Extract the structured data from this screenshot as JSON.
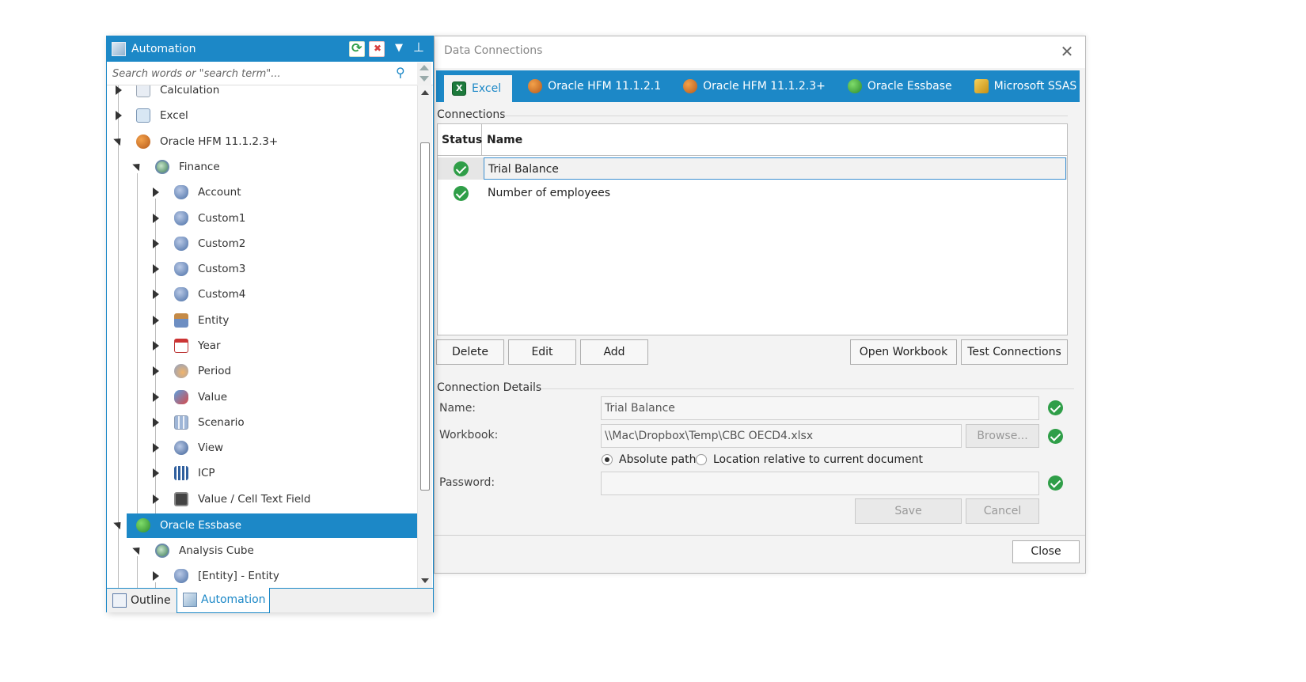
{
  "dialog": {
    "title": "Data Connections",
    "tabs": [
      {
        "label": "Excel",
        "icon": "excel-icon",
        "active": true
      },
      {
        "label": "Oracle HFM 11.1.2.1",
        "icon": "oracle-hfm-icon"
      },
      {
        "label": "Oracle HFM 11.1.2.3+",
        "icon": "oracle-hfm-icon"
      },
      {
        "label": "Oracle Essbase",
        "icon": "oracle-essbase-icon"
      },
      {
        "label": "Microsoft SSAS",
        "icon": "microsoft-ssas-icon"
      }
    ],
    "connections_label": "Connections",
    "grid_headers": {
      "status": "Status",
      "name": "Name"
    },
    "connections": [
      {
        "name": "Trial Balance",
        "status": "ok",
        "selected": true
      },
      {
        "name": "Number of employees",
        "status": "ok",
        "selected": false
      }
    ],
    "buttons": {
      "delete": "Delete",
      "edit": "Edit",
      "add": "Add",
      "open_workbook": "Open Workbook",
      "test_connections": "Test Connections"
    },
    "details": {
      "label": "Connection Details",
      "name_label": "Name:",
      "name_value": "Trial Balance",
      "workbook_label": "Workbook:",
      "workbook_value": "\\\\Mac\\Dropbox\\Temp\\CBC OECD4.xlsx",
      "browse": "Browse...",
      "absolute_path": "Absolute path",
      "relative_path": "Location relative to current document",
      "path_mode": "absolute",
      "password_label": "Password:",
      "password_value": "",
      "save": "Save",
      "cancel": "Cancel"
    },
    "close": "Close"
  },
  "panel": {
    "title": "Automation",
    "search_placeholder": "Search words or \"search term\"...",
    "tree": [
      {
        "label": "Calculation",
        "icon": "calculation-icon",
        "depth": 0,
        "expander": "collapsed"
      },
      {
        "label": "Excel",
        "icon": "excel-icon",
        "depth": 0,
        "expander": "collapsed"
      },
      {
        "label": "Oracle HFM 11.1.2.3+",
        "icon": "oracle-hfm-icon",
        "depth": 0,
        "expander": "expanded"
      },
      {
        "label": "Finance",
        "icon": "cube-icon",
        "depth": 1,
        "expander": "expanded"
      },
      {
        "label": "Account",
        "icon": "account-dimension-icon",
        "depth": 2,
        "expander": "collapsed"
      },
      {
        "label": "Custom1",
        "icon": "custom-dimension-icon",
        "depth": 2,
        "expander": "collapsed"
      },
      {
        "label": "Custom2",
        "icon": "custom-dimension-icon",
        "depth": 2,
        "expander": "collapsed"
      },
      {
        "label": "Custom3",
        "icon": "custom-dimension-icon",
        "depth": 2,
        "expander": "collapsed"
      },
      {
        "label": "Custom4",
        "icon": "custom-dimension-icon",
        "depth": 2,
        "expander": "collapsed"
      },
      {
        "label": "Entity",
        "icon": "entity-dimension-icon",
        "depth": 2,
        "expander": "collapsed"
      },
      {
        "label": "Year",
        "icon": "calendar-icon",
        "depth": 2,
        "expander": "collapsed"
      },
      {
        "label": "Period",
        "icon": "period-dimension-icon",
        "depth": 2,
        "expander": "collapsed"
      },
      {
        "label": "Value",
        "icon": "value-dimension-icon",
        "depth": 2,
        "expander": "collapsed"
      },
      {
        "label": "Scenario",
        "icon": "scenario-dimension-icon",
        "depth": 2,
        "expander": "collapsed"
      },
      {
        "label": "View",
        "icon": "view-dimension-icon",
        "depth": 2,
        "expander": "collapsed"
      },
      {
        "label": "ICP",
        "icon": "icp-dimension-icon",
        "depth": 2,
        "expander": "collapsed"
      },
      {
        "label": "Value / Cell Text Field",
        "icon": "cell-text-icon",
        "depth": 2,
        "expander": "collapsed"
      },
      {
        "label": "Oracle Essbase",
        "icon": "oracle-essbase-icon",
        "depth": 0,
        "expander": "expanded",
        "selected": true
      },
      {
        "label": "Analysis Cube",
        "icon": "cube-icon",
        "depth": 1,
        "expander": "expanded"
      },
      {
        "label": "[Entity] - Entity",
        "icon": "custom-dimension-icon",
        "depth": 2,
        "expander": "collapsed"
      }
    ],
    "bottom_tabs": [
      {
        "label": "Outline",
        "active": false
      },
      {
        "label": "Automation",
        "active": true
      }
    ]
  }
}
